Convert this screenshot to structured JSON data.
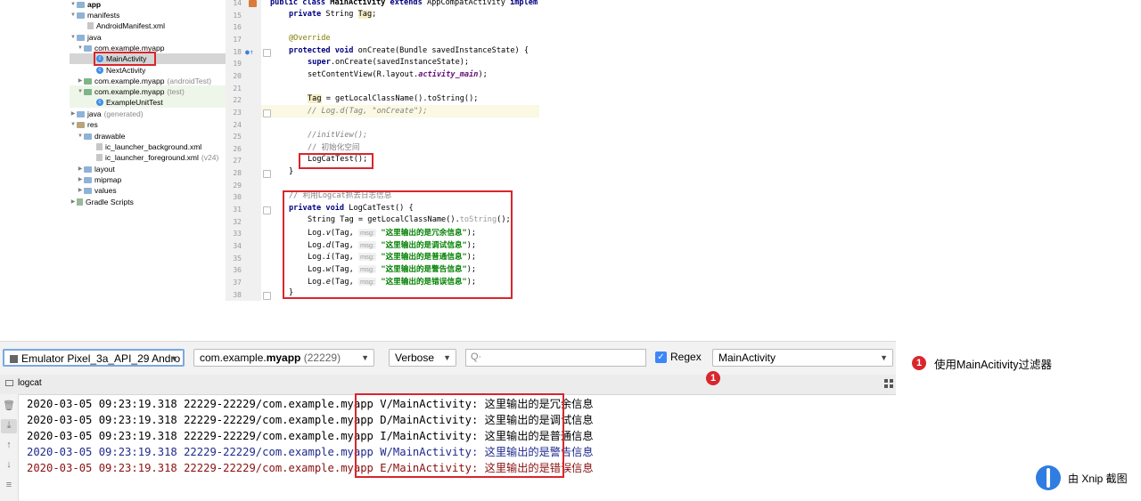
{
  "project_tree": {
    "app": "app",
    "manifests": "manifests",
    "android_manifest": "AndroidManifest.xml",
    "java": "java",
    "pkg_main": "com.example.myapp",
    "main_activity": "MainActivity",
    "next_activity": "NextActivity",
    "pkg_android_test": "com.example.myapp",
    "android_test_tag": "(androidTest)",
    "pkg_test": "com.example.myapp",
    "test_tag": "(test)",
    "example_unit_test": "ExampleUnitTest",
    "java_generated": "java",
    "generated_tag": "(generated)",
    "res": "res",
    "drawable": "drawable",
    "ic_launcher_background": "ic_launcher_background.xml",
    "ic_launcher_foreground": "ic_launcher_foreground.xml",
    "v24_tag": "(v24)",
    "layout": "layout",
    "mipmap": "mipmap",
    "values": "values",
    "gradle_scripts": "Gradle Scripts"
  },
  "editor": {
    "line_numbers": [
      "14",
      "15",
      "16",
      "17",
      "18",
      "19",
      "20",
      "21",
      "22",
      "23",
      "24",
      "25",
      "26",
      "27",
      "28",
      "29",
      "30",
      "31",
      "32",
      "33",
      "34",
      "35",
      "36",
      "37",
      "38"
    ],
    "l14": {
      "kw1": "public class ",
      "name": "MainActivity ",
      "kw2": "extends ",
      "rest": "AppCompatActivity ",
      "kw3": "implem"
    },
    "l15": {
      "kw": "private ",
      "type": "String ",
      "var": "Tag",
      "end": ";"
    },
    "l17": "@Override",
    "l18": {
      "kw": "protected void ",
      "rest": "onCreate(Bundle savedInstanceState) {"
    },
    "l19": {
      "kw": "super",
      "rest": ".onCreate(savedInstanceState);"
    },
    "l20": {
      "a": "setContentView(R.layout.",
      "b": "activity_main",
      "c": ");"
    },
    "l22": {
      "var": "Tag",
      "rest": " = getLocalClassName().toString();"
    },
    "l23": "// Log.d(Tag, \"onCreate\");",
    "l25": "//initView();",
    "l26": "// 初始化空间",
    "l27": "LogCatTest();",
    "l28": "}",
    "l30": "// 利用Logcat抓去日志信息",
    "l31": {
      "kw": "private void ",
      "rest": "LogCatTest() {"
    },
    "l32": {
      "a": "String Tag = getLocalClassName().",
      "b": "toString",
      "c": "();"
    },
    "hint": "msg:",
    "log_calls": [
      {
        "pre": "Log.",
        "m": "v",
        "args": "(Tag, ",
        "str": "\"这里输出的是冗余信息\"",
        "end": ");"
      },
      {
        "pre": "Log.",
        "m": "d",
        "args": "(Tag, ",
        "str": "\"这里输出的是调试信息\"",
        "end": ");"
      },
      {
        "pre": "Log.",
        "m": "i",
        "args": "(Tag, ",
        "str": "\"这里输出的是普通信息\"",
        "end": ");"
      },
      {
        "pre": "Log.",
        "m": "w",
        "args": "(Tag, ",
        "str": "\"这里输出的是警告信息\"",
        "end": ");"
      },
      {
        "pre": "Log.",
        "m": "e",
        "args": "(Tag, ",
        "str": "\"这里输出的是错误信息\"",
        "end": ");"
      }
    ],
    "l38": "}"
  },
  "toolbar": {
    "device": "Emulator Pixel_3a_API_29 Andro",
    "process_prefix": "com.example.",
    "process_bold": "myapp",
    "process_pid": "(22229)",
    "level": "Verbose",
    "search_placeholder": "",
    "regex_label": "Regex",
    "regex_checked": true,
    "filter": "MainActivity"
  },
  "tab": {
    "label": "logcat"
  },
  "log_lines": [
    {
      "prefix": "2020-03-05 09:23:19.318 22229-22229/com.example.myapp ",
      "msg": "V/MainActivity: 这里输出的是冗余信息",
      "level": "V"
    },
    {
      "prefix": "2020-03-05 09:23:19.318 22229-22229/com.example.myapp ",
      "msg": "D/MainActivity: 这里输出的是调试信息",
      "level": "D"
    },
    {
      "prefix": "2020-03-05 09:23:19.318 22229-22229/com.example.myapp ",
      "msg": "I/MainActivity: 这里输出的是普通信息",
      "level": "I"
    },
    {
      "prefix": "2020-03-05 09:23:19.318 22229-22229/com.example.myapp ",
      "msg": "W/MainActivity: 这里输出的是警告信息",
      "level": "W"
    },
    {
      "prefix": "2020-03-05 09:23:19.318 22229-22229/com.example.myapp ",
      "msg": "E/MainActivity: 这里输出的是错误信息",
      "level": "E"
    }
  ],
  "annotation": {
    "badge": "1",
    "legend": "使用MainAcitivity过滤器"
  },
  "watermark": {
    "text": "由 Xnip 截图"
  },
  "colors": {
    "highlight_red": "#d9262c",
    "warn_blue": "#1e2a8c",
    "error_red": "#8b1010",
    "checkbox_blue": "#3d86f7"
  }
}
